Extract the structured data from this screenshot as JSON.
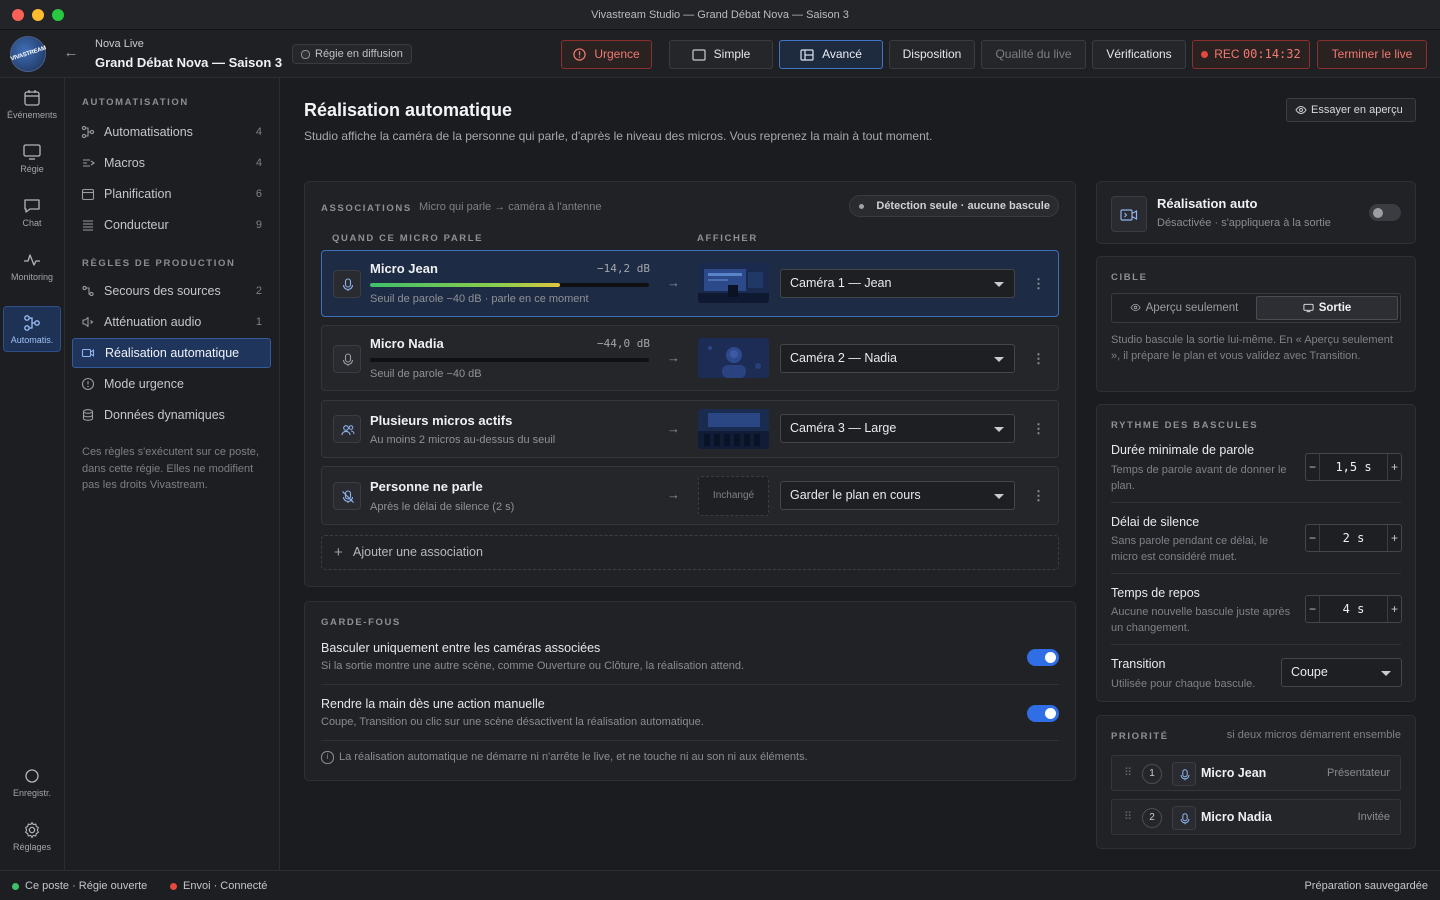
{
  "window": {
    "title": "Vivastream Studio — Grand Débat Nova — Saison 3"
  },
  "header": {
    "logo_text": "VIVASTREAM",
    "project_label": "Nova Live",
    "project_title": "Grand Débat Nova — Saison 3",
    "regie_badge": "Régie en diffusion",
    "urgence": "Urgence",
    "simple": "Simple",
    "avance": "Avancé",
    "disposition": "Disposition",
    "qualite": "Qualité du live",
    "verifications": "Vérifications",
    "rec_label": "REC",
    "rec_time": "00:14:32",
    "end_live": "Terminer le live"
  },
  "rail": [
    {
      "label": "Événements",
      "icon": "calendar-icon"
    },
    {
      "label": "Régie",
      "icon": "monitor-icon"
    },
    {
      "label": "Chat",
      "icon": "chat-icon"
    },
    {
      "label": "Monitoring",
      "icon": "pulse-icon"
    },
    {
      "label": "Automatis.",
      "icon": "automation-icon"
    },
    {
      "label": "Enregistr.",
      "icon": "record-icon"
    },
    {
      "label": "Réglages",
      "icon": "gear-icon"
    }
  ],
  "sidenav": {
    "section1": "AUTOMATISATION",
    "section2": "RÈGLES DE PRODUCTION",
    "items": [
      {
        "label": "Automatisations",
        "count": "4"
      },
      {
        "label": "Macros",
        "count": "4"
      },
      {
        "label": "Planification",
        "count": "6"
      },
      {
        "label": "Conducteur",
        "count": "9"
      },
      {
        "label": "Secours des sources",
        "count": "2"
      },
      {
        "label": "Atténuation audio",
        "count": "1"
      },
      {
        "label": "Réalisation automatique",
        "count": ""
      },
      {
        "label": "Mode urgence",
        "count": ""
      },
      {
        "label": "Données dynamiques",
        "count": ""
      }
    ],
    "note": "Ces règles s'exécutent sur ce poste, dans cette régie. Elles ne modifient pas les droits Vivastream."
  },
  "main": {
    "title": "Réalisation automatique",
    "desc": "Studio affiche la caméra de la personne qui parle, d'après le niveau des micros. Vous reprenez la main à tout moment.",
    "preview_btn": "Essayer en aperçu",
    "assoc": {
      "caption": "ASSOCIATIONS",
      "sub": "Micro qui parle → caméra à l'antenne",
      "badge": "Détection seule · aucune bascule",
      "col1": "QUAND CE MICRO PARLE",
      "col2": "AFFICHER",
      "rows": [
        {
          "name": "Micro Jean",
          "db": "−14,2 dB",
          "level": 0.68,
          "sub": "Seuil de parole −40 dB · parle en ce moment",
          "camera": "Caméra 1 — Jean"
        },
        {
          "name": "Micro Nadia",
          "db": "−44,0 dB",
          "level": 0.0,
          "sub": "Seuil de parole −40 dB",
          "camera": "Caméra 2 — Nadia"
        },
        {
          "name": "Plusieurs micros actifs",
          "sub": "Au moins 2 micros au-dessus du seuil",
          "camera": "Caméra 3 — Large"
        },
        {
          "name": "Personne ne parle",
          "sub": "Après le délai de silence (2 s)",
          "thumb_text": "Inchangé",
          "camera": "Garder le plan en cours"
        }
      ],
      "add": "Ajouter une association"
    },
    "guard": {
      "caption": "GARDE-FOUS",
      "items": [
        {
          "title": "Basculer uniquement entre les caméras associées",
          "sub": "Si la sortie montre une autre scène, comme Ouverture ou Clôture, la réalisation attend."
        },
        {
          "title": "Rendre la main dès une action manuelle",
          "sub": "Coupe, Transition ou clic sur une scène désactivent la réalisation automatique."
        }
      ],
      "note": "La réalisation automatique ne démarre ni n'arrête le live, et ne touche ni au son ni aux éléments."
    }
  },
  "right": {
    "auto": {
      "title": "Réalisation auto",
      "sub": "Désactivée · s'appliquera à la sortie"
    },
    "cible": {
      "caption": "CIBLE",
      "opt1": "Aperçu seulement",
      "opt2": "Sortie",
      "desc": "Studio bascule la sortie lui-même. En « Aperçu seulement », il prépare le plan et vous validez avec Transition."
    },
    "rythme": {
      "caption": "RYTHME DES BASCULES",
      "items": [
        {
          "title": "Durée minimale de parole",
          "sub": "Temps de parole avant de donner le plan.",
          "value": "1,5 s"
        },
        {
          "title": "Délai de silence",
          "sub": "Sans parole pendant ce délai, le micro est considéré muet.",
          "value": "2 s"
        },
        {
          "title": "Temps de repos",
          "sub": "Aucune nouvelle bascule juste après un changement.",
          "value": "4 s"
        }
      ],
      "transition_title": "Transition",
      "transition_sub": "Utilisée pour chaque bascule.",
      "transition_value": "Coupe"
    },
    "prio": {
      "caption": "PRIORITÉ",
      "sub": "si deux micros démarrent ensemble",
      "items": [
        {
          "num": "1",
          "name": "Micro Jean",
          "role": "Présentateur"
        },
        {
          "num": "2",
          "name": "Micro Nadia",
          "role": "Invitée"
        }
      ]
    }
  },
  "status": {
    "left1": "Ce poste · Régie ouverte",
    "left2": "Envoi · Connecté",
    "right": "Préparation sauvegardée"
  },
  "colors": {
    "accent": "#2f6ee5",
    "danger": "#e5483e",
    "ok": "#3fbf6a"
  }
}
